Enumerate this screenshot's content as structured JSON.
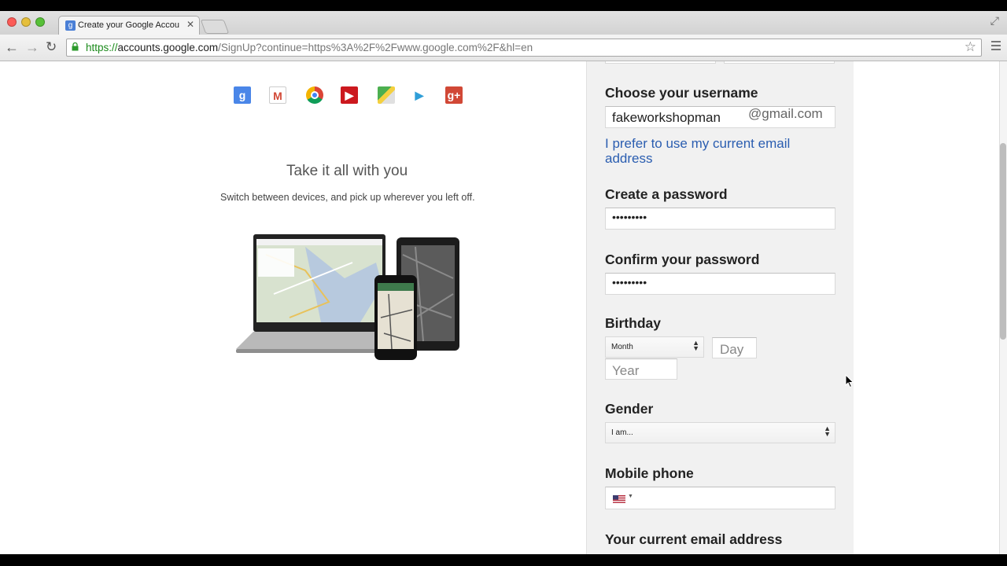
{
  "browser": {
    "tab_title": "Create your Google Accou",
    "tab_favicon": "g",
    "url_scheme": "https://",
    "url_host": "accounts.google.com",
    "url_path": "/SignUp?continue=https%3A%2F%2Fwww.google.com%2F&hl=en",
    "icons": [
      "back-arrow-icon",
      "forward-arrow-icon",
      "reload-icon",
      "lock-icon",
      "star-icon",
      "menu-icon",
      "close-icon",
      "resize-icon"
    ]
  },
  "promo": {
    "products": [
      {
        "name": "google-search-icon",
        "glyph": "g",
        "color": "#4a86e8"
      },
      {
        "name": "gmail-icon",
        "glyph": "M",
        "color": "#d14836"
      },
      {
        "name": "chrome-icon",
        "glyph": "",
        "color": "#e8b41e"
      },
      {
        "name": "youtube-icon",
        "glyph": "▶",
        "color": "#cc181e"
      },
      {
        "name": "maps-icon",
        "glyph": "",
        "color": "#4caf50"
      },
      {
        "name": "play-icon",
        "glyph": "▶",
        "color": "#2f9ed8"
      },
      {
        "name": "google-plus-icon",
        "glyph": "g+",
        "color": "#d14836"
      }
    ],
    "headline": "Take it all with you",
    "subline": "Switch between devices, and pick up wherever you left off."
  },
  "form": {
    "username_label": "Choose your username",
    "username_value": "fakeworkshopman",
    "username_suffix": "@gmail.com",
    "prefer_link": "I prefer to use my current email address",
    "password_label": "Create a password",
    "password_value": "•••••••••",
    "confirm_label": "Confirm your password",
    "confirm_value": "•••••••••",
    "birthday_label": "Birthday",
    "month_select": "Month",
    "day_placeholder": "Day",
    "year_placeholder": "Year",
    "gender_label": "Gender",
    "gender_select": "I am...",
    "mobile_label": "Mobile phone",
    "current_email_label": "Your current email address"
  }
}
